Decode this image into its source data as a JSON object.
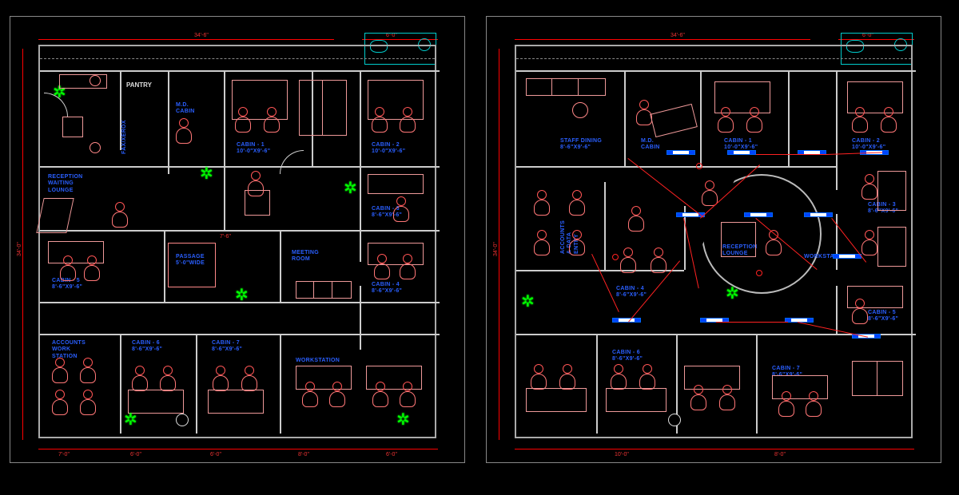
{
  "plan_a": {
    "dimensions": {
      "top_total": "34'-6\"",
      "top_right": "6'-0\"",
      "left_total": "34'-0\""
    },
    "rooms": {
      "pantry": "PANTRY",
      "fax_xerox": "FAX/XEROX",
      "md_cabin": "M.D.\nCABIN",
      "reception": "RECEPTION\nWAITING\nLOUNGE",
      "cabin_1": "CABIN - 1\n10'-0\"X9'-6\"",
      "cabin_2": "CABIN - 2\n10'-0\"X9'-6\"",
      "cabin_3": "CABIN - 3\n8'-6\"X9'-6\"",
      "cabin_4": "CABIN - 4\n8'-6\"X9'-6\"",
      "cabin_5": "CABIN - 5\n8'-6\"X9'-6\"",
      "cabin_6": "CABIN - 6\n8'-6\"X9'-6\"",
      "cabin_7": "CABIN - 7\n8'-6\"X9'-6\"",
      "passage": "PASSAGE\n5'-0\"WIDE",
      "meeting": "MEETING\nROOM",
      "accounts": "ACCOUNTS\nWORK\nSTATION",
      "ws1": "WORKSTATION",
      "corridor_dim": "7'-6\""
    },
    "bottom_dims": [
      "7'-0\"",
      "6'-0\"",
      "6'-0\"",
      "8'-0\"",
      "6'-0\""
    ]
  },
  "plan_b": {
    "dimensions": {
      "top_total": "34'-6\"",
      "top_right": "6'-0\"",
      "left_total": "34'-0\""
    },
    "rooms": {
      "md_cabin": "M.D.\nCABIN",
      "staff_dining": "STAFF DINING\n8'-6\"X9'-6\"",
      "cabin_1": "CABIN - 1\n10'-0\"X9'-6\"",
      "cabin_2": "CABIN - 2\n10'-0\"X9'-6\"",
      "cabin_3": "CABIN - 3\n8'-6\"X9'-6\"",
      "cabin_4": "CABIN - 4\n8'-6\"X9'-6\"",
      "cabin_5": "CABIN - 5\n8'-6\"X9'-6\"",
      "cabin_6": "CABIN - 6\n8'-6\"X9'-6\"",
      "cabin_7": "CABIN - 7\n8'-6\"X9'-6\"",
      "accounts": "ACCOUNTS\n& DATA\nENTRY",
      "reception": "RECEPTION\nLOUNGE",
      "workstation": "WORKSTATION"
    },
    "bottom_dims": [
      "10'-0\"",
      "8'-0\""
    ]
  },
  "colors": {
    "walls": "#cccccc",
    "furniture": "#ff7777",
    "dimensions": "#ff0000",
    "labels": "#2a5fff",
    "plants": "#00ff00",
    "plumbing": "#00cccc"
  }
}
